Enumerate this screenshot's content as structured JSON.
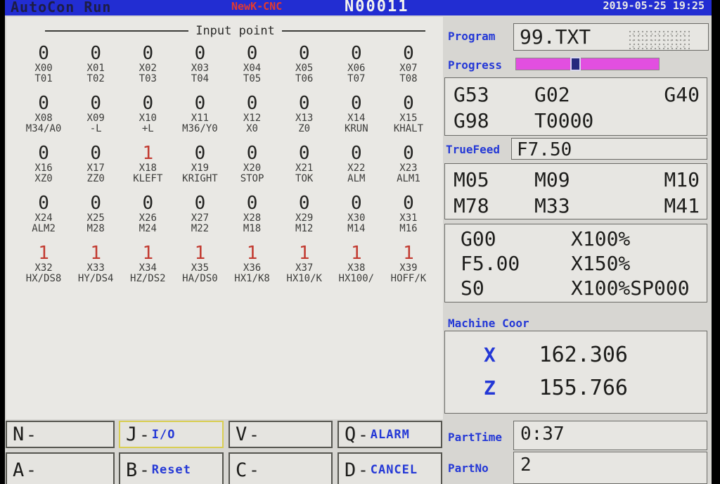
{
  "titlebar": {
    "app": "AutoCon Run",
    "brand": "NewK-CNC",
    "block_no": "N00011",
    "datetime": "2019-05-25 19:25"
  },
  "input_panel": {
    "title": "Input point",
    "rows": [
      {
        "cells": [
          {
            "value": "0",
            "red": false,
            "l1": "X00",
            "l2": "T01"
          },
          {
            "value": "0",
            "red": false,
            "l1": "X01",
            "l2": "T02"
          },
          {
            "value": "0",
            "red": false,
            "l1": "X02",
            "l2": "T03"
          },
          {
            "value": "0",
            "red": false,
            "l1": "X03",
            "l2": "T04"
          },
          {
            "value": "0",
            "red": false,
            "l1": "X04",
            "l2": "T05"
          },
          {
            "value": "0",
            "red": false,
            "l1": "X05",
            "l2": "T06"
          },
          {
            "value": "0",
            "red": false,
            "l1": "X06",
            "l2": "T07"
          },
          {
            "value": "0",
            "red": false,
            "l1": "X07",
            "l2": "T08"
          }
        ]
      },
      {
        "cells": [
          {
            "value": "0",
            "red": false,
            "l1": "X08",
            "l2": "M34/A0"
          },
          {
            "value": "0",
            "red": false,
            "l1": "X09",
            "l2": "-L"
          },
          {
            "value": "0",
            "red": false,
            "l1": "X10",
            "l2": "+L"
          },
          {
            "value": "0",
            "red": false,
            "l1": "X11",
            "l2": "M36/Y0"
          },
          {
            "value": "0",
            "red": false,
            "l1": "X12",
            "l2": "X0"
          },
          {
            "value": "0",
            "red": false,
            "l1": "X13",
            "l2": "Z0"
          },
          {
            "value": "0",
            "red": false,
            "l1": "X14",
            "l2": "KRUN"
          },
          {
            "value": "0",
            "red": false,
            "l1": "X15",
            "l2": "KHALT"
          }
        ]
      },
      {
        "cells": [
          {
            "value": "0",
            "red": false,
            "l1": "X16",
            "l2": "XZ0"
          },
          {
            "value": "0",
            "red": false,
            "l1": "X17",
            "l2": "ZZ0"
          },
          {
            "value": "1",
            "red": true,
            "l1": "X18",
            "l2": "KLEFT"
          },
          {
            "value": "0",
            "red": false,
            "l1": "X19",
            "l2": "KRIGHT"
          },
          {
            "value": "0",
            "red": false,
            "l1": "X20",
            "l2": "STOP"
          },
          {
            "value": "0",
            "red": false,
            "l1": "X21",
            "l2": "TOK"
          },
          {
            "value": "0",
            "red": false,
            "l1": "X22",
            "l2": "ALM"
          },
          {
            "value": "0",
            "red": false,
            "l1": "X23",
            "l2": "ALM1"
          }
        ]
      },
      {
        "cells": [
          {
            "value": "0",
            "red": false,
            "l1": "X24",
            "l2": "ALM2"
          },
          {
            "value": "0",
            "red": false,
            "l1": "X25",
            "l2": "M28"
          },
          {
            "value": "0",
            "red": false,
            "l1": "X26",
            "l2": "M24"
          },
          {
            "value": "0",
            "red": false,
            "l1": "X27",
            "l2": "M22"
          },
          {
            "value": "0",
            "red": false,
            "l1": "X28",
            "l2": "M18"
          },
          {
            "value": "0",
            "red": false,
            "l1": "X29",
            "l2": "M12"
          },
          {
            "value": "0",
            "red": false,
            "l1": "X30",
            "l2": "M14"
          },
          {
            "value": "0",
            "red": false,
            "l1": "X31",
            "l2": "M16"
          }
        ]
      },
      {
        "cells": [
          {
            "value": "1",
            "red": true,
            "l1": "X32",
            "l2": "HX/DS8"
          },
          {
            "value": "1",
            "red": true,
            "l1": "X33",
            "l2": "HY/DS4"
          },
          {
            "value": "1",
            "red": true,
            "l1": "X34",
            "l2": "HZ/DS2"
          },
          {
            "value": "1",
            "red": true,
            "l1": "X35",
            "l2": "HA/DS0"
          },
          {
            "value": "1",
            "red": true,
            "l1": "X36",
            "l2": "HX1/K8"
          },
          {
            "value": "1",
            "red": true,
            "l1": "X37",
            "l2": "HX10/K"
          },
          {
            "value": "1",
            "red": true,
            "l1": "X38",
            "l2": "HX100/"
          },
          {
            "value": "1",
            "red": true,
            "l1": "X39",
            "l2": "HOFF/K"
          }
        ]
      }
    ]
  },
  "right_panel": {
    "program_label": "Program",
    "program_value": "99.TXT",
    "progress_label": "Progress",
    "progress_percent": 42,
    "gcode": {
      "rows": [
        [
          "G53",
          "G02",
          "G40"
        ],
        [
          "G98",
          "T0000",
          ""
        ]
      ]
    },
    "truefeed_label": "TrueFeed",
    "truefeed_value": "F7.50",
    "mcode": {
      "rows": [
        [
          "M05",
          "M09",
          "M10"
        ],
        [
          "M78",
          "M33",
          "M41"
        ]
      ]
    },
    "override": {
      "rows": [
        [
          "G00",
          "X100%"
        ],
        [
          "F5.00",
          "X150%"
        ],
        [
          "S0",
          "X100%SP000"
        ]
      ]
    },
    "machine_coor_label": "Machine Coor",
    "coords": {
      "rows": [
        {
          "axis": "X",
          "value": "162.306"
        },
        {
          "axis": "Z",
          "value": "155.766"
        }
      ]
    },
    "parttime_label": "PartTime",
    "parttime_value": "0:37",
    "partno_label": "PartNo",
    "partno_value": "2"
  },
  "softkeys": {
    "rows": [
      [
        {
          "key": "N",
          "suffix": "",
          "active": false
        },
        {
          "key": "J",
          "suffix": "I/O",
          "active": true
        },
        {
          "key": "V",
          "suffix": "",
          "active": false
        },
        {
          "key": "Q",
          "suffix": "ALARM",
          "active": false
        }
      ],
      [
        {
          "key": "A",
          "suffix": "",
          "active": false
        },
        {
          "key": "B",
          "suffix": "Reset",
          "active": false
        },
        {
          "key": "C",
          "suffix": "",
          "active": false
        },
        {
          "key": "D",
          "suffix": "CANCEL",
          "active": false
        }
      ]
    ]
  },
  "colors": {
    "titlebar_blue": "#222dd2",
    "accent_blue": "#2438d6",
    "alert_red": "#c23a30",
    "progress_magenta": "#e24fe0"
  }
}
